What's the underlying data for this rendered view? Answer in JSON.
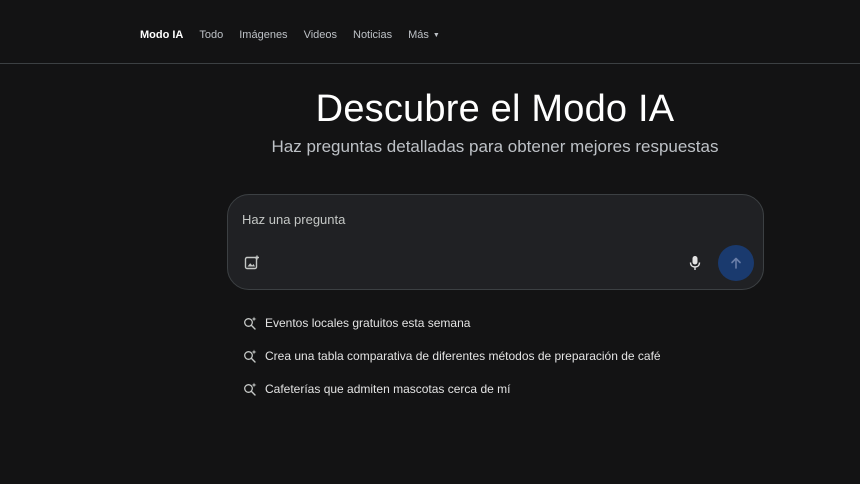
{
  "nav": {
    "tabs": [
      {
        "label": "Modo IA",
        "active": true
      },
      {
        "label": "Todo"
      },
      {
        "label": "Imágenes"
      },
      {
        "label": "Videos"
      },
      {
        "label": "Noticias"
      },
      {
        "label": "Más",
        "has_dropdown": true
      }
    ]
  },
  "hero": {
    "title": "Descubre el Modo IA",
    "subtitle": "Haz preguntas detalladas para obtener mejores respuestas"
  },
  "ask": {
    "placeholder": "Haz una pregunta",
    "image_icon": "add-image-icon",
    "mic_icon": "microphone-icon",
    "send_icon": "arrow-up-icon"
  },
  "suggestions": [
    {
      "icon": "search-sparkle-icon",
      "text": "Eventos locales gratuitos esta semana"
    },
    {
      "icon": "search-sparkle-icon",
      "text": "Crea una tabla comparativa de diferentes métodos de preparación de café"
    },
    {
      "icon": "search-sparkle-icon",
      "text": "Cafeterías que admiten mascotas cerca de mí"
    }
  ],
  "colors": {
    "background": "#131314",
    "box": "#202124",
    "send_button": "#1a3a6e",
    "text": "#e3e3e3"
  }
}
